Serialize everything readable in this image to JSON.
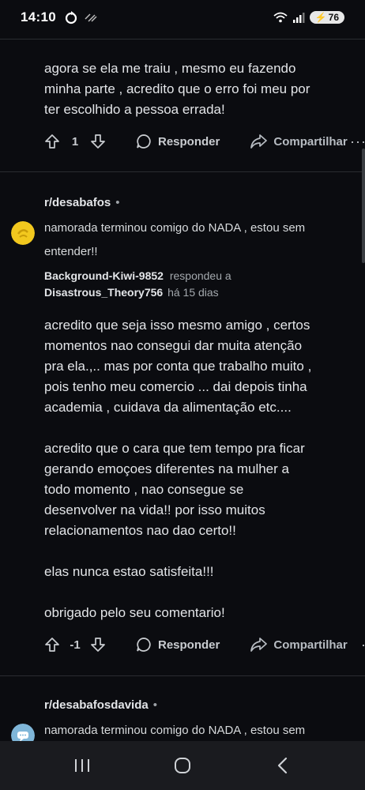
{
  "status_bar": {
    "time": "14:10",
    "battery": "76",
    "icons": [
      "sync-icon",
      "wifi-off-icon",
      "wifi-icon",
      "signal-icon",
      "battery-icon"
    ]
  },
  "comments": [
    {
      "paragraphs": [
        "agora se ela me traiu , mesmo eu fazendo minha parte , acredito que o erro foi meu por ter escolhido a pessoa errada!"
      ],
      "vote_count": "1",
      "reply_label": "Responder",
      "share_label": "Compartilhar",
      "more_label": "···"
    },
    {
      "subreddit": "r/desabafos",
      "subreddit_dot": "•",
      "post_title": "namorada terminou comigo do NADA , estou sem entender!!",
      "author": "Background-Kiwi-9852",
      "replied_label": "respondeu a",
      "replied_to": "Disastrous_Theory756",
      "time_ago": "há 15 dias",
      "paragraphs": [
        "acredito que seja isso mesmo amigo , certos momentos nao consegui dar muita atenção pra ela.,.. mas por conta que trabalho muito , pois tenho meu comercio ... dai depois tinha academia , cuidava da alimentação etc....",
        "acredito que o cara que tem tempo pra ficar gerando emoçoes diferentes na mulher a todo momento , nao consegue se desenvolver na vida!! por isso muitos relacionamentos nao dao certo!!",
        "elas nunca estao satisfeita!!!",
        "obrigado pelo seu comentario!"
      ],
      "vote_count": "-1",
      "reply_label": "Responder",
      "share_label": "Compartilhar",
      "more_label": "·"
    },
    {
      "subreddit": "r/desabafosdavida",
      "subreddit_dot": "•",
      "post_title": "namorada terminou comigo do NADA , estou sem entender!!"
    }
  ],
  "colors": {
    "background": "#0b0c10",
    "avatar_desabafos": "#f2c81e",
    "avatar_desabafosdavida": "#7fb6d8"
  }
}
